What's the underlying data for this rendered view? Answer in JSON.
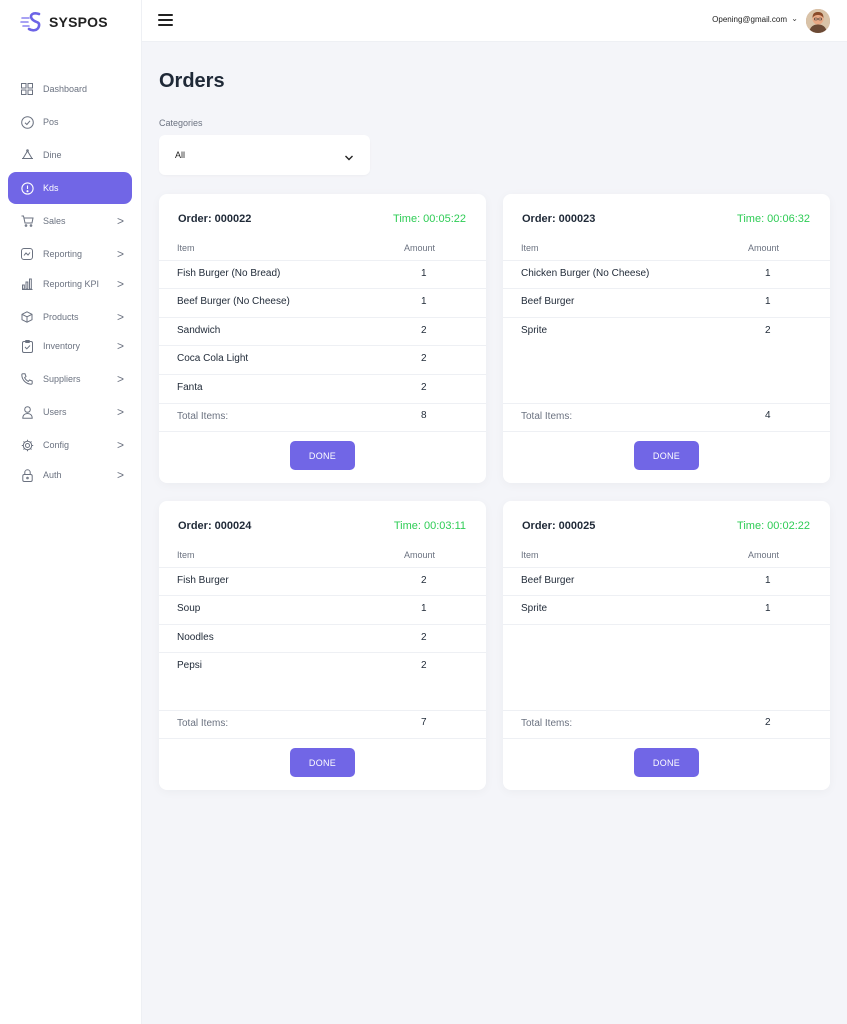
{
  "brand": {
    "name": "SYSPOS"
  },
  "topbar": {
    "email": "Opening@gmail.com",
    "caret": "⌄"
  },
  "page": {
    "title": "Orders",
    "categories_label": "Categories",
    "categories_value": "All"
  },
  "sidebar": {
    "items": [
      {
        "label": "Dashboard",
        "icon": "grid-icon"
      },
      {
        "label": "Pos",
        "icon": "check-circle-icon"
      },
      {
        "label": "Dine",
        "icon": "cloche-icon"
      },
      {
        "label": "Kds",
        "icon": "alert-circle-icon",
        "active": true
      },
      {
        "label": "Sales",
        "icon": "cart-icon",
        "chevron": ">"
      },
      {
        "label": "Reporting",
        "icon": "chart-square-icon",
        "chevron": ">"
      },
      {
        "label": "Reporting KPI",
        "icon": "bar-chart-icon",
        "chevron": ">"
      },
      {
        "label": "Products",
        "icon": "box-icon",
        "chevron": ">"
      },
      {
        "label": "Inventory",
        "icon": "clipboard-icon",
        "chevron": ">"
      },
      {
        "label": "Suppliers",
        "icon": "phone-icon",
        "chevron": ">"
      },
      {
        "label": "Users",
        "icon": "user-icon",
        "chevron": ">"
      },
      {
        "label": "Config",
        "icon": "gear-icon",
        "chevron": ">"
      },
      {
        "label": "Auth",
        "icon": "lock-icon",
        "chevron": ">"
      }
    ]
  },
  "table_labels": {
    "item": "Item",
    "amount": "Amount",
    "total": "Total Items:",
    "done": "DONE"
  },
  "orders": [
    {
      "number": "Order: 000022",
      "time": "Time: 00:05:22",
      "items": [
        {
          "name": "Fish Burger (No Bread)",
          "amount": "1"
        },
        {
          "name": "Beef Burger (No Cheese)",
          "amount": "1"
        },
        {
          "name": "Sandwich",
          "amount": "2"
        },
        {
          "name": "Coca Cola Light",
          "amount": "2"
        },
        {
          "name": "Fanta",
          "amount": "2"
        }
      ],
      "total": "8"
    },
    {
      "number": "Order: 000023",
      "time": "Time: 00:06:32",
      "items": [
        {
          "name": "Chicken Burger (No Cheese)",
          "amount": "1"
        },
        {
          "name": "Beef Burger",
          "amount": "1"
        },
        {
          "name": "Sprite",
          "amount": "2"
        }
      ],
      "total": "4"
    },
    {
      "number": "Order: 000024",
      "time": "Time: 00:03:11",
      "items": [
        {
          "name": "Fish Burger",
          "amount": "2"
        },
        {
          "name": "Soup",
          "amount": "1"
        },
        {
          "name": "Noodles",
          "amount": "2"
        },
        {
          "name": "Pepsi",
          "amount": "2"
        }
      ],
      "total": "7"
    },
    {
      "number": "Order: 000025",
      "time": "Time: 00:02:22",
      "items": [
        {
          "name": "Beef Burger",
          "amount": "1"
        },
        {
          "name": "Sprite",
          "amount": "1"
        }
      ],
      "total": "2"
    }
  ],
  "colors": {
    "accent": "#7166e6",
    "time_green": "#2ecc55",
    "background": "#f4f5f9"
  }
}
